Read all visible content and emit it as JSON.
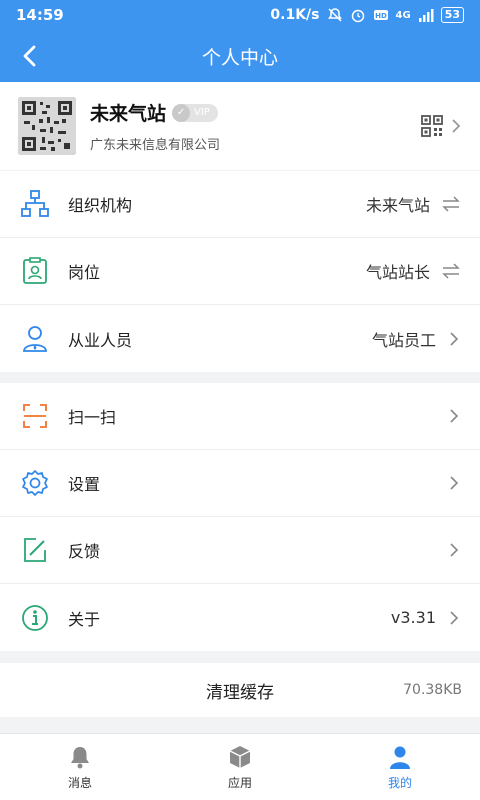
{
  "status_bar": {
    "time": "14:59",
    "speed": "0.1K/s",
    "network": "4G",
    "battery": "53"
  },
  "app_bar": {
    "title": "个人中心"
  },
  "profile": {
    "name": "未来气站",
    "badge": "VIP",
    "company": "广东未来信息有限公司"
  },
  "org_section": [
    {
      "label": "组织机构",
      "value": "未来气站",
      "action": "swap"
    },
    {
      "label": "岗位",
      "value": "气站站长",
      "action": "swap"
    },
    {
      "label": "从业人员",
      "value": "气站员工",
      "action": "chevron"
    }
  ],
  "tools_section": [
    {
      "label": "扫一扫",
      "value": ""
    },
    {
      "label": "设置",
      "value": ""
    },
    {
      "label": "反馈",
      "value": ""
    },
    {
      "label": "关于",
      "value": "v3.31"
    }
  ],
  "cache": {
    "label": "清理缓存",
    "size": "70.38KB"
  },
  "tabs": [
    {
      "label": "消息",
      "active": false
    },
    {
      "label": "应用",
      "active": false
    },
    {
      "label": "我的",
      "active": true
    }
  ],
  "colors": {
    "primary": "#3d95f0",
    "active_tab": "#2f86ea",
    "icon_blue": "#2f86ea",
    "icon_green": "#2aa775",
    "icon_orange": "#f0732a"
  }
}
